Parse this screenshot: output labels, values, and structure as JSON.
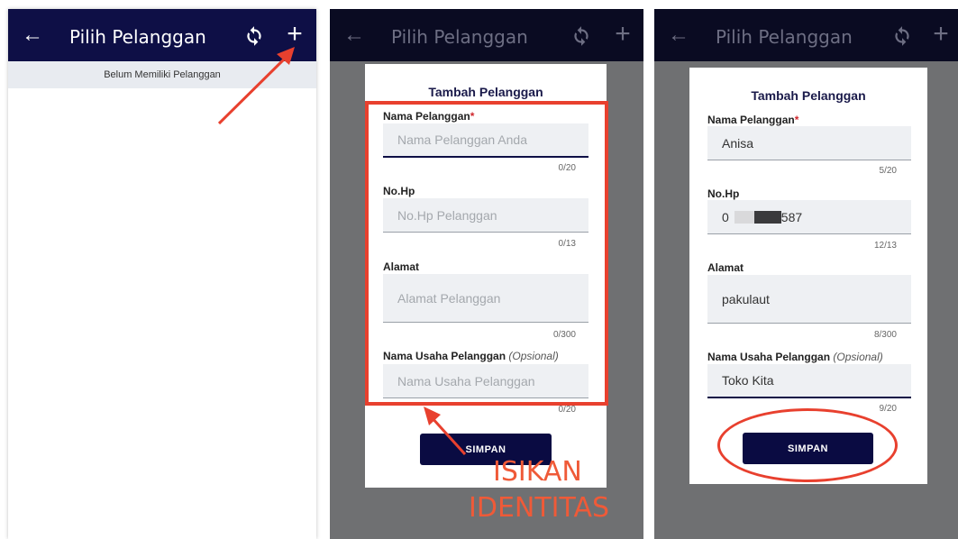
{
  "screens": [
    {
      "appbar": {
        "back_icon": "←",
        "title": "Pilih Pelanggan",
        "refresh_icon": "refresh-icon",
        "add_icon": "+"
      },
      "empty_message": "Belum Memiliki Pelanggan"
    },
    {
      "appbar": {
        "back_icon": "←",
        "title": "Pilih Pelanggan",
        "refresh_icon": "refresh-icon",
        "add_icon": "+"
      },
      "dialog": {
        "title": "Tambah Pelanggan",
        "fields": [
          {
            "label": "Nama Pelanggan",
            "required_mark": "*",
            "placeholder": "Nama Pelanggan Anda",
            "counter": "0/20"
          },
          {
            "label": "No.Hp",
            "placeholder": "No.Hp Pelanggan",
            "counter": "0/13"
          },
          {
            "label": "Alamat",
            "placeholder": "Alamat Pelanggan",
            "counter": "0/300"
          },
          {
            "label": "Nama Usaha Pelanggan",
            "optional_note": "(Opsional)",
            "placeholder": "Nama Usaha Pelanggan",
            "counter": "0/20"
          }
        ],
        "save_label": "SIMPAN"
      },
      "annotation": {
        "line1": "ISIKAN",
        "line2": "IDENTITAS"
      }
    },
    {
      "appbar": {
        "back_icon": "←",
        "title": "Pilih Pelanggan",
        "refresh_icon": "refresh-icon",
        "add_icon": "+"
      },
      "dialog": {
        "title": "Tambah Pelanggan",
        "fields": [
          {
            "label": "Nama Pelanggan",
            "required_mark": "*",
            "value": "Anisa",
            "counter": "5/20"
          },
          {
            "label": "No.Hp",
            "value_prefix": "0",
            "value_suffix": "587",
            "counter": "12/13"
          },
          {
            "label": "Alamat",
            "value": "pakulaut",
            "counter": "8/300"
          },
          {
            "label": "Nama Usaha Pelanggan",
            "optional_note": "(Opsional)",
            "value": "Toko Kita",
            "counter": "9/20"
          }
        ],
        "save_label": "SIMPAN"
      }
    }
  ],
  "colors": {
    "appbar": "#0e0f46",
    "button": "#0a0b42",
    "annotation": "#e8402e",
    "required": "#d0282e"
  }
}
